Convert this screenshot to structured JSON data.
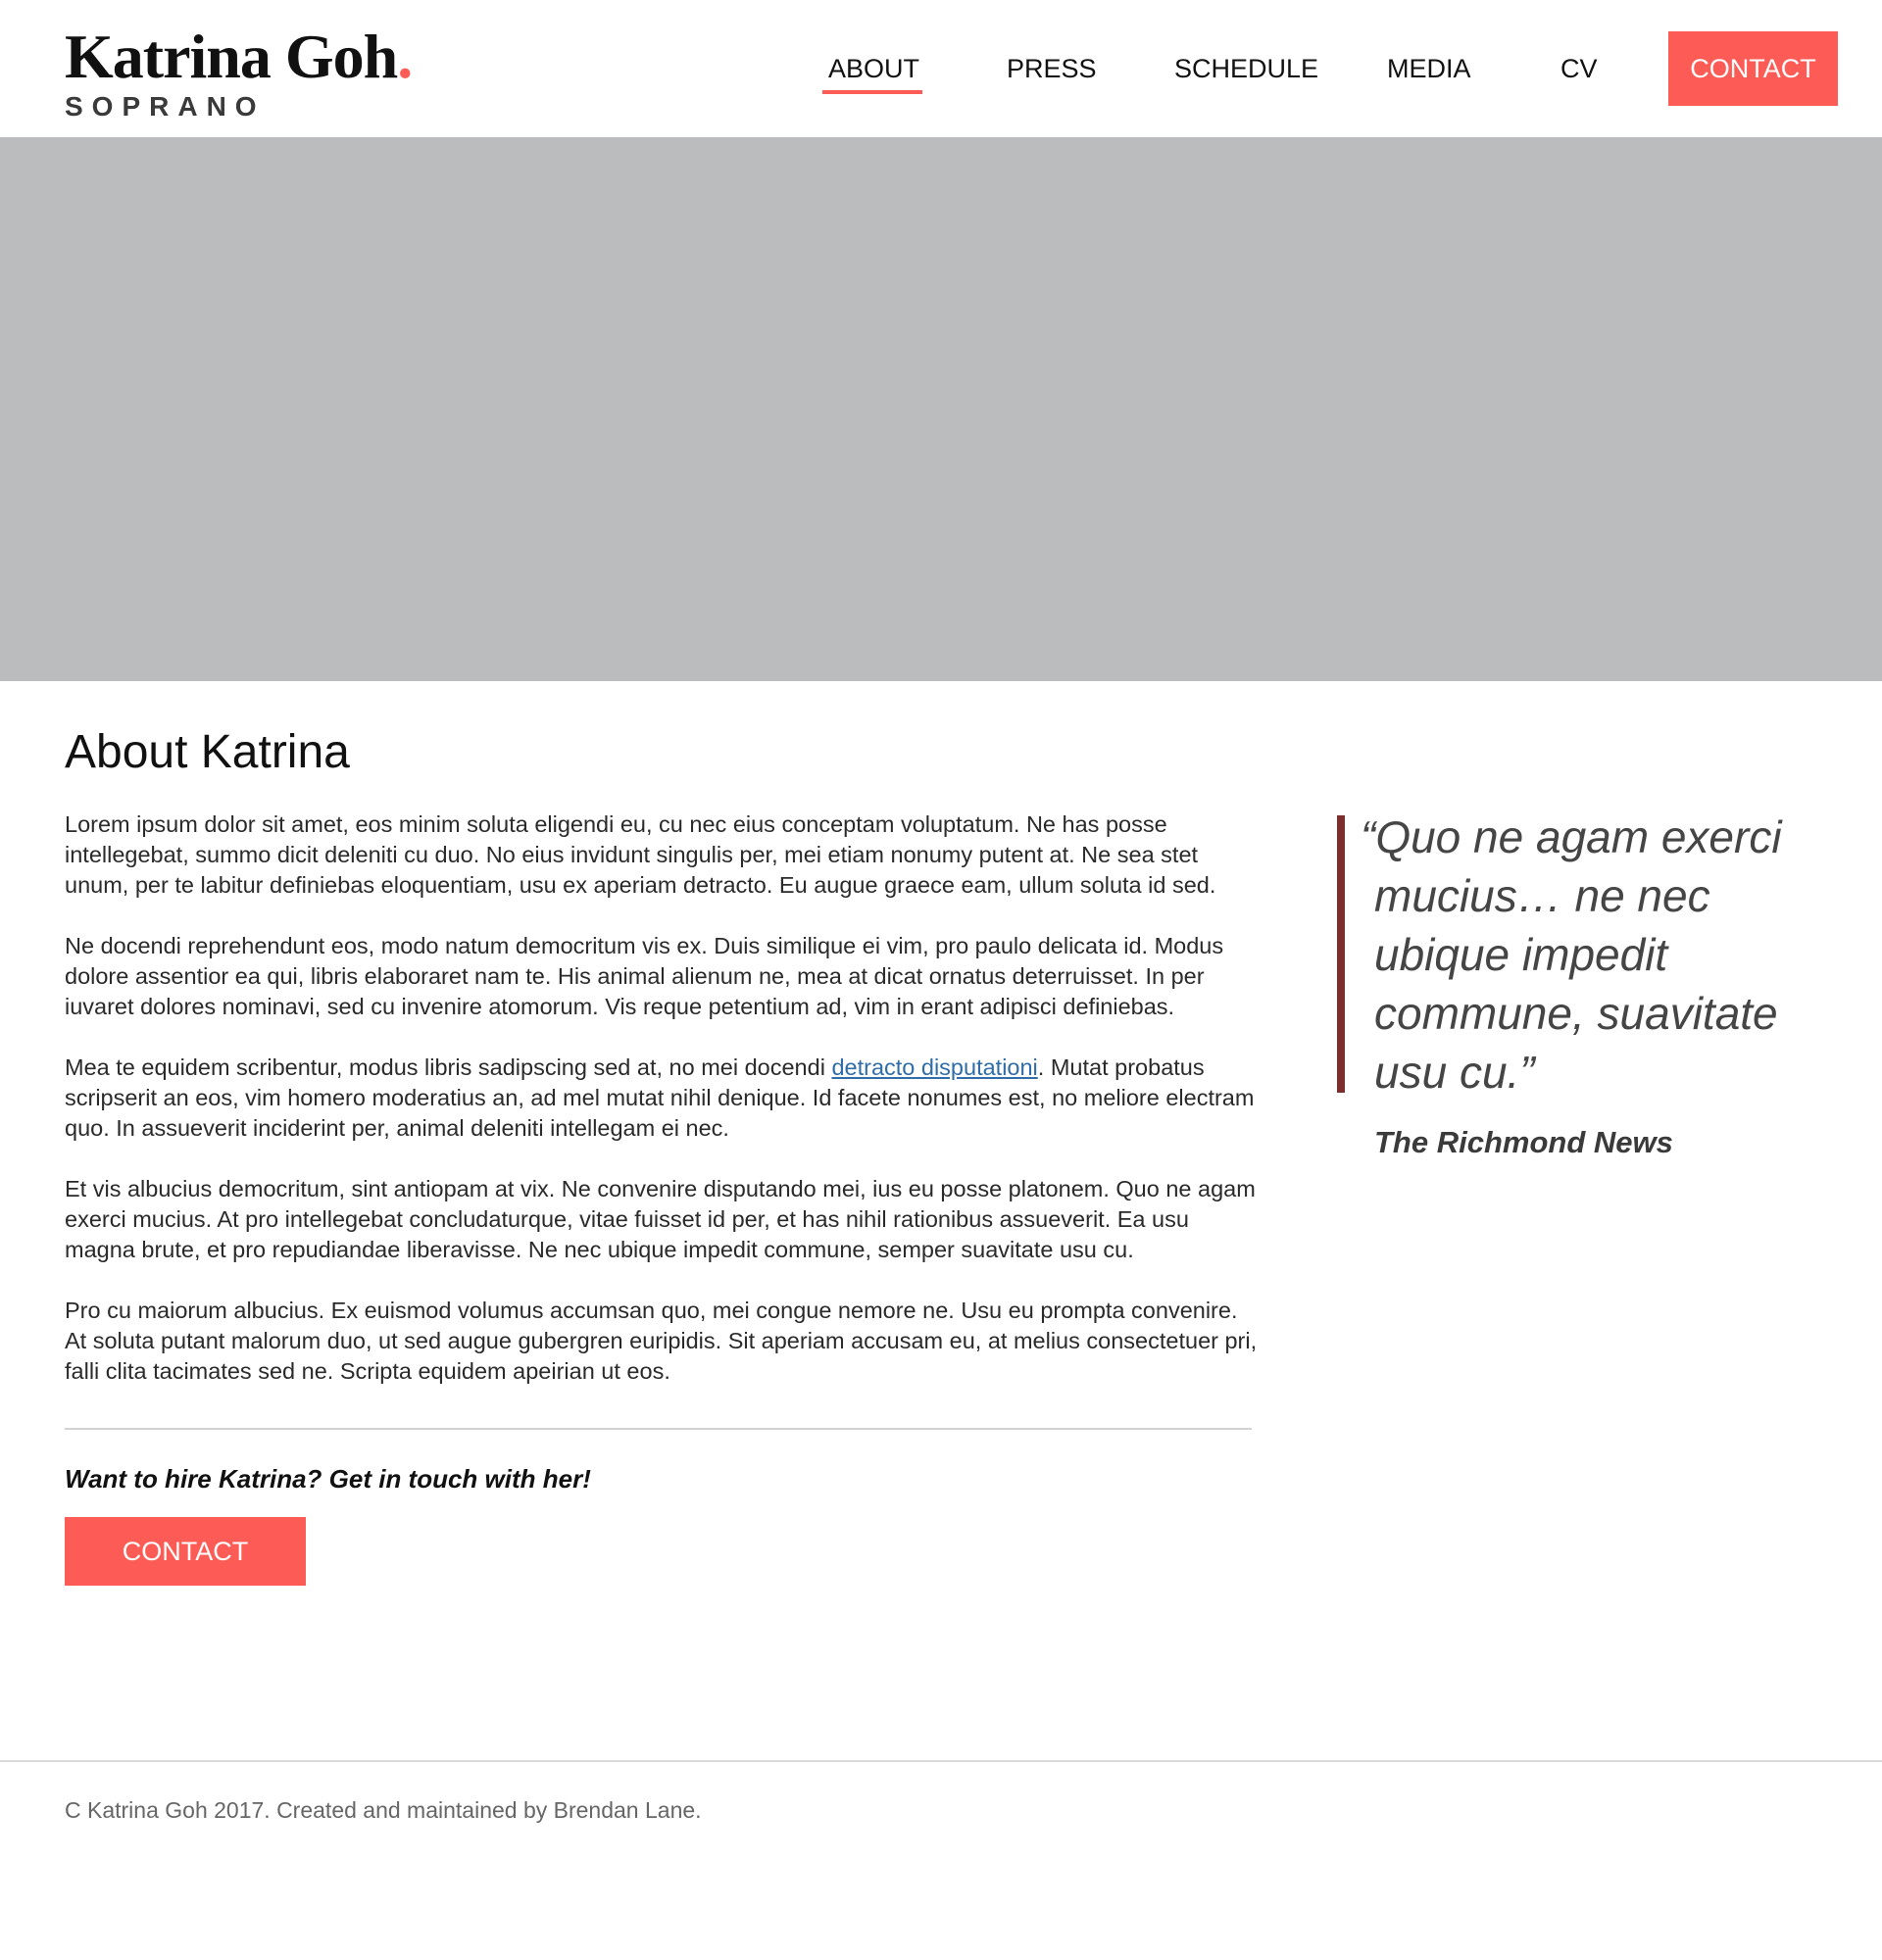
{
  "brand": {
    "name": "Katrina Goh",
    "dot": ".",
    "subtitle": "SOPRANO"
  },
  "nav": {
    "items": [
      {
        "label": "ABOUT",
        "active": true
      },
      {
        "label": "PRESS",
        "active": false
      },
      {
        "label": "SCHEDULE",
        "active": false
      },
      {
        "label": "MEDIA",
        "active": false
      },
      {
        "label": "CV",
        "active": false
      }
    ],
    "contact_label": "CONTACT"
  },
  "main": {
    "heading": "About Katrina",
    "paragraphs": [
      "Lorem ipsum dolor sit amet, eos minim soluta eligendi eu, cu nec eius conceptam voluptatum. Ne has posse intellegebat, summo dicit deleniti cu duo. No eius invidunt singulis per, mei etiam nonumy putent at. Ne sea stet unum, per te labitur definiebas eloquentiam, usu ex aperiam detracto. Eu augue graece eam, ullum soluta id sed.",
      "Ne docendi reprehendunt eos, modo natum democritum vis ex. Duis similique ei vim, pro paulo delicata id. Modus dolore assentior ea qui, libris elaboraret nam te. His animal alienum ne, mea at dicat ornatus deterruisset. In per iuvaret dolores nominavi, sed cu invenire atomorum. Vis reque petentium ad, vim in erant adipisci definiebas.",
      {
        "before": "Mea te equidem scribentur, modus libris sadipscing sed at, no mei docendi ",
        "link": "detracto disputationi",
        "after": ". Mutat probatus scripserit an eos, vim homero moderatius an, ad mel mutat nihil denique. Id facete nonumes est, no meliore electram quo. In assueverit inciderint per, animal deleniti intellegam ei nec."
      },
      "Et vis albucius democritum, sint antiopam at vix. Ne convenire disputando mei, ius eu posse platonem. Quo ne agam exerci mucius. At pro intellegebat concludaturque, vitae fuisset id per, et has nihil rationibus assueverit. Ea usu magna brute, et pro repudiandae liberavisse. Ne nec ubique impedit commune, semper suavitate usu cu.",
      "Pro cu maiorum albucius. Ex euismod volumus accumsan quo, mei congue nemore ne. Usu eu prompta convenire. At soluta putant malorum duo, ut sed augue gubergren euripidis. Sit aperiam accusam eu, at melius consectetuer pri, falli clita tacimates sed ne. Scripta equidem apeirian ut eos."
    ],
    "cta_text": "Want to hire Katrina? Get in touch with her!",
    "cta_button": "CONTACT"
  },
  "quote": {
    "text": "“Quo ne agam exerci mucius… ne nec ubique impedit commune, suavitate usu cu.”",
    "source": "The Richmond News"
  },
  "footer": {
    "text": "C Katrina Goh 2017. Created and maintained by Brendan Lane."
  },
  "colors": {
    "accent": "#fd5c56",
    "hero": "#bbbcbe",
    "quote_bar": "#7c2e2e",
    "link": "#2f6da8"
  }
}
